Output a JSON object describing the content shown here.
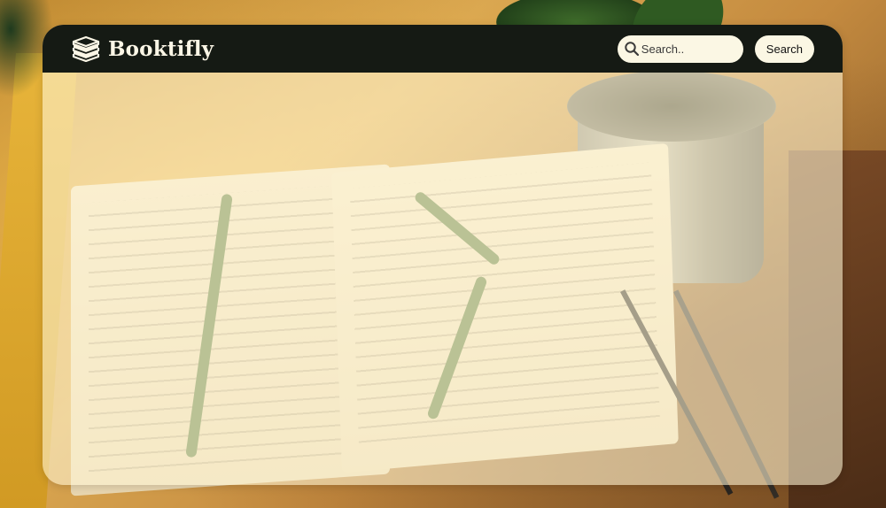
{
  "navbar": {
    "brand": {
      "name": "Booktifly",
      "icon": "book-stack-icon"
    },
    "search": {
      "placeholder": "Search..",
      "value": "",
      "icon": "search-icon",
      "button_label": "Search"
    }
  },
  "colors": {
    "navbar_bg": "#151a14",
    "card_tint": "#fff7d6",
    "input_bg": "#fbf7e4",
    "brand_text": "#fbf6e6"
  }
}
